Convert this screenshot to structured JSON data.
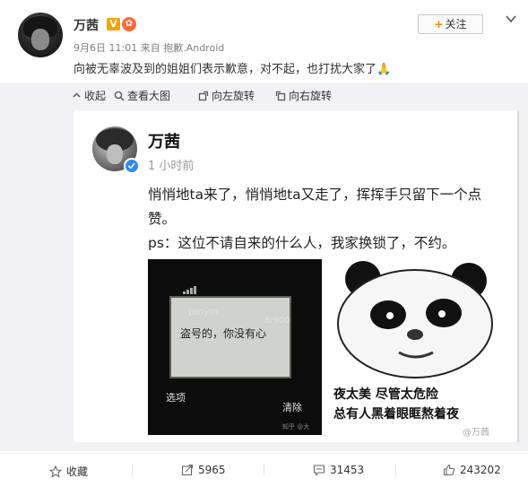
{
  "header": {
    "user_name": "万茜",
    "verified_label": "V",
    "date": "9月6日 11:01",
    "source_prefix": "来自",
    "source": "抱歉.Android",
    "post_text": "向被无辜波及到的姐姐们表示歉意，对不起，也打扰大家了",
    "post_emoji": "🙏",
    "follow_label": "关注"
  },
  "tools": {
    "collapse": "收起",
    "view_large": "查看大图",
    "rotate_left": "向左旋转",
    "rotate_right": "向右旋转"
  },
  "screenshot": {
    "name": "万茜",
    "time": "1 小时前",
    "body_line1": "悄悄地ta来了，悄悄地ta又走了，挥挥手只留下一个点赞。",
    "body_line2": "ps：这位不请自来的什么人，我家换锁了，不约。",
    "phone": {
      "brand": "pinyin",
      "count": "8/900",
      "message": "盗号的，你没有心",
      "left_soft": "选项",
      "right_soft": "清除",
      "watermark": "知乎 @大"
    },
    "panda": {
      "line1": "夜太美 尽管太危险",
      "line2": "总有人黑着眼眶熬着夜"
    },
    "watermark": "@万茜"
  },
  "actions": {
    "favorite": "收藏",
    "repost": "5965",
    "comment": "31453",
    "like": "243202"
  },
  "colors": {
    "accent": "#ff8200",
    "verified": "#2d8cf0",
    "media_bg": "#f2f2f5"
  }
}
